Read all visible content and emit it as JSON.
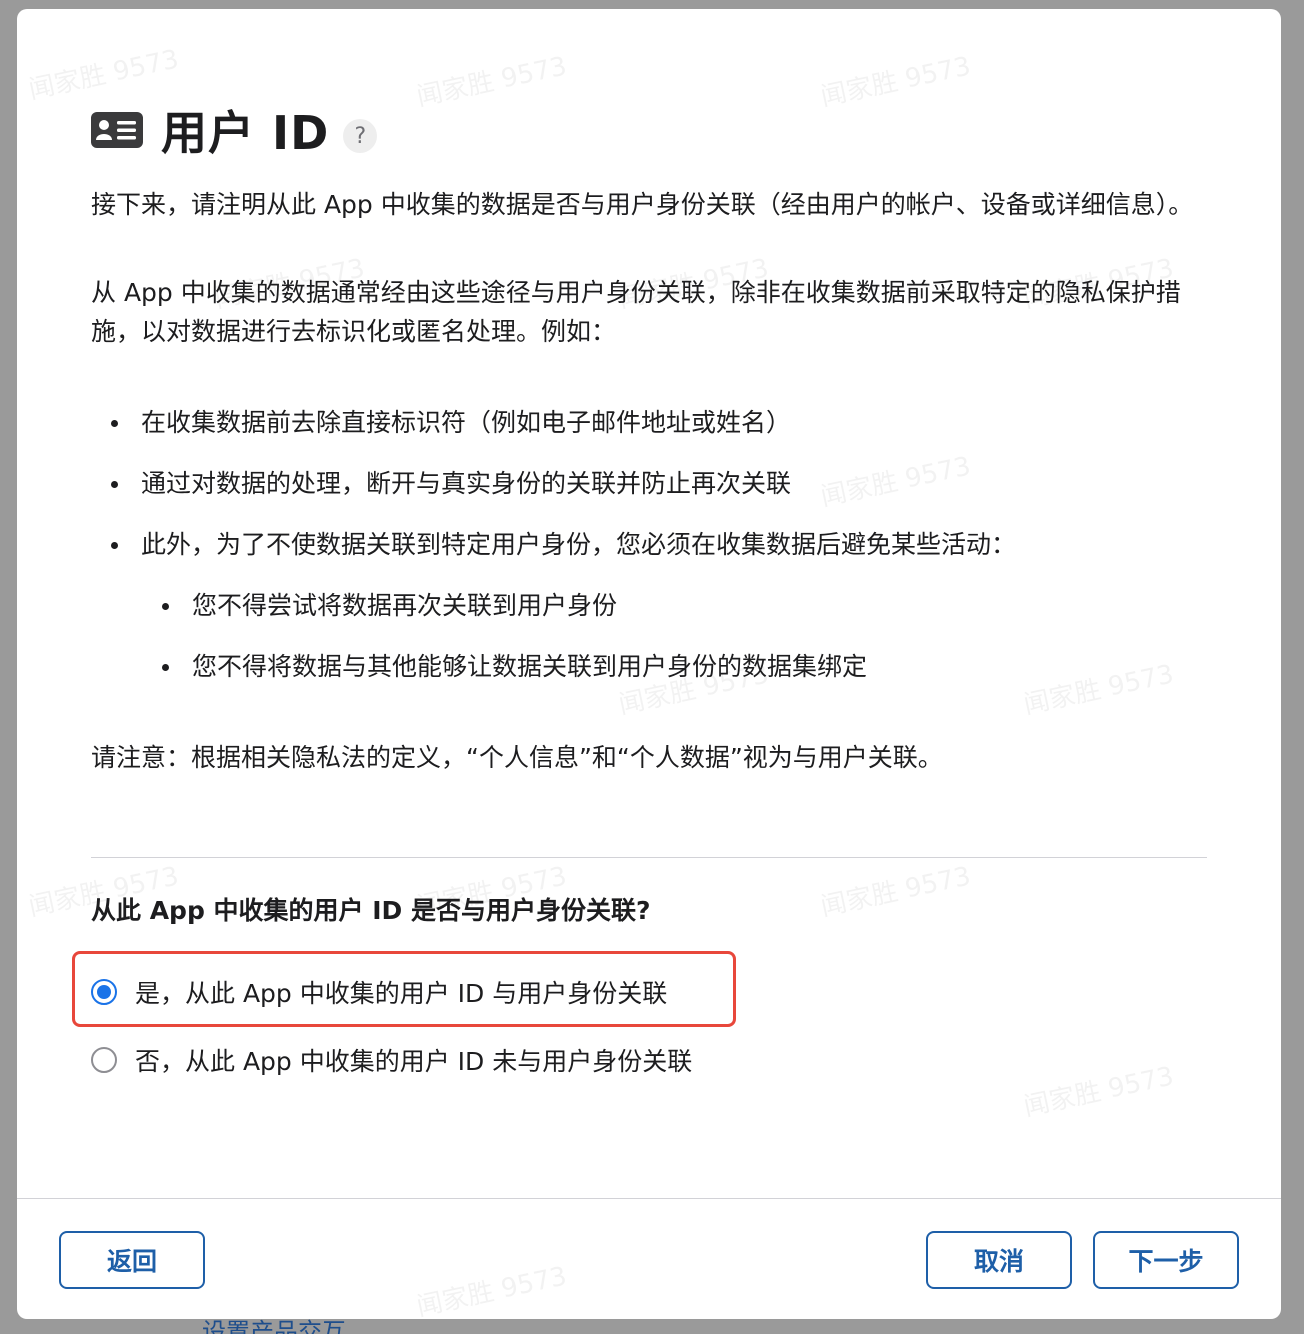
{
  "dialog": {
    "title": "用户 ID",
    "help_label": "?",
    "intro": "接下来，请注明从此 App 中收集的数据是否与用户身份关联（经由用户的帐户、设备或详细信息）。",
    "paragraph2": "从 App 中收集的数据通常经由这些途径与用户身份关联，除非在收集数据前采取特定的隐私保护措施，以对数据进行去标识化或匿名处理。例如：",
    "bullets": [
      "在收集数据前去除直接标识符（例如电子邮件地址或姓名）",
      "通过对数据的处理，断开与真实身份的关联并防止再次关联",
      "此外，为了不使数据关联到特定用户身份，您必须在收集数据后避免某些活动：",
      "您不得尝试将数据再次关联到用户身份",
      "您不得将数据与其他能够让数据关联到用户身份的数据集绑定"
    ],
    "note": "请注意：根据相关隐私法的定义，“个人信息”和“个人数据”视为与用户关联。",
    "question": "从此 App 中收集的用户 ID 是否与用户身份关联?",
    "options": [
      {
        "label": "是，从此 App 中收集的用户 ID 与用户身份关联",
        "selected": true
      },
      {
        "label": "否，从此 App 中收集的用户 ID 未与用户身份关联",
        "selected": false
      }
    ],
    "buttons": {
      "back": "返回",
      "cancel": "取消",
      "next": "下一步"
    }
  },
  "watermark_text": "闻家胜 9573",
  "background_text": "设置产品交互",
  "colors": {
    "accent": "#1e5fa8",
    "radio_selected": "#1a73e8",
    "highlight": "#e8473b"
  }
}
